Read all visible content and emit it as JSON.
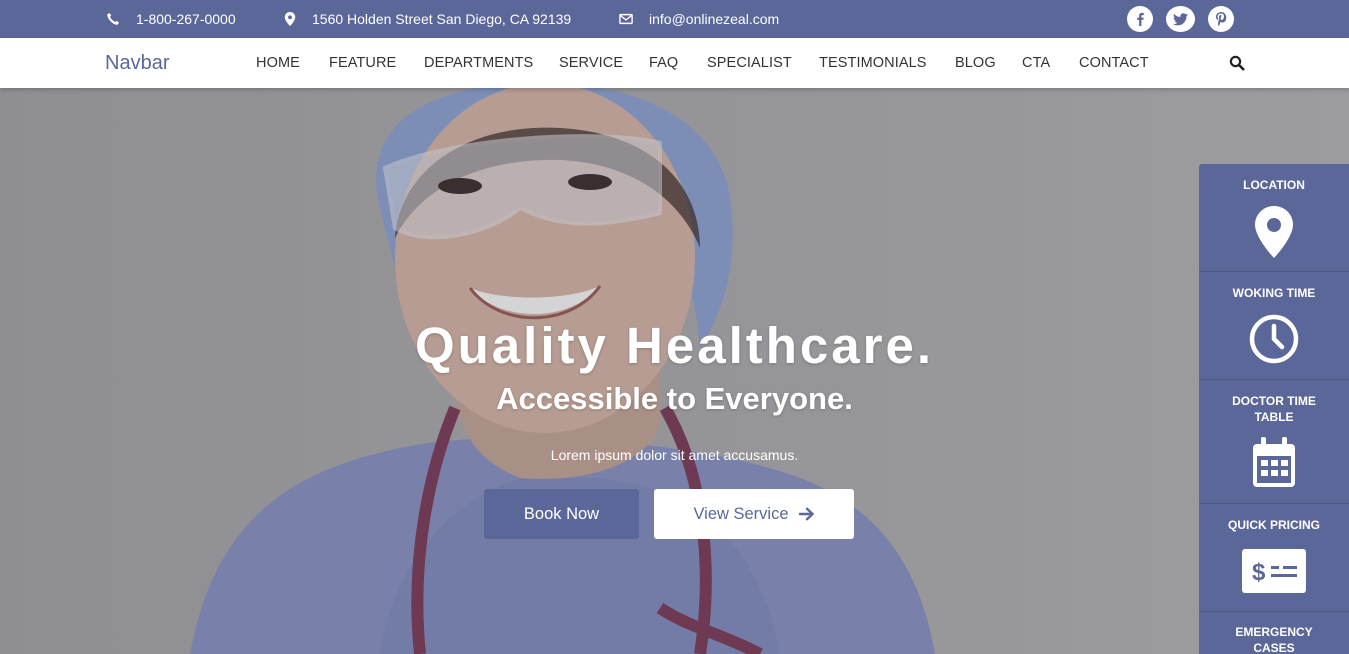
{
  "topbar": {
    "phone": "1-800-267-0000",
    "address": "1560 Holden Street San Diego, CA 92139",
    "email": "info@onlinezeal.com",
    "social": [
      "facebook",
      "twitter",
      "pinterest"
    ]
  },
  "navbar": {
    "brand": "Navbar",
    "links": [
      "HOME",
      "FEATURE",
      "DEPARTMENTS",
      "SERVICE",
      "FAQ",
      "SPECIALIST",
      "TESTIMONIALS",
      "BLOG",
      "CTA",
      "CONTACT"
    ],
    "search_icon": "search-icon"
  },
  "hero": {
    "title": "Quality Healthcare.",
    "subtitle": "Accessible to Everyone.",
    "text": "Lorem ipsum dolor sit amet accusamus.",
    "book_label": "Book Now",
    "view_label": "View Service"
  },
  "side_panel": {
    "items": [
      {
        "label": "LOCATION",
        "icon": "map-pin-icon"
      },
      {
        "label": "WOKING TIME",
        "icon": "clock-icon"
      },
      {
        "label": "DOCTOR TIME TABLE",
        "icon": "calendar-icon"
      },
      {
        "label": "QUICK PRICING",
        "icon": "money-check-icon"
      },
      {
        "label": "EMERGENCY CASES",
        "icon": "emergency-icon"
      }
    ]
  },
  "colors": {
    "primary": "#5b6798",
    "white": "#ffffff",
    "nav_text": "#333333"
  }
}
